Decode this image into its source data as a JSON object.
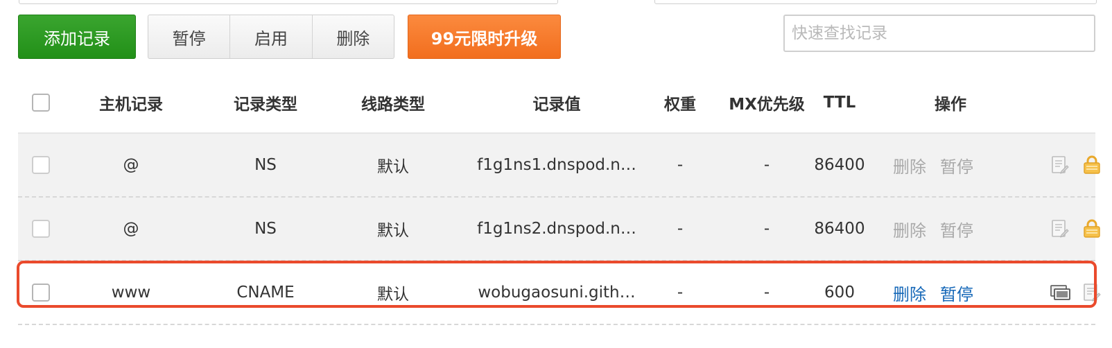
{
  "toolbar": {
    "add_label": "添加记录",
    "pause_label": "暂停",
    "enable_label": "启用",
    "delete_label": "删除",
    "upgrade_label": "99元限时升级",
    "search_placeholder": "快速查找记录"
  },
  "table": {
    "headers": {
      "host": "主机记录",
      "type": "记录类型",
      "line": "线路类型",
      "value": "记录值",
      "weight": "权重",
      "mx": "MX优先级",
      "ttl": "TTL",
      "ops": "操作"
    },
    "rows": [
      {
        "host": "@",
        "type": "NS",
        "line": "默认",
        "value": "f1g1ns1.dnspod.n…",
        "weight": "-",
        "mx": "-",
        "ttl": "86400",
        "delete": "删除",
        "pause": "暂停",
        "state": "disabled",
        "icons": [
          "edit-doc-icon",
          "lock-icon"
        ]
      },
      {
        "host": "@",
        "type": "NS",
        "line": "默认",
        "value": "f1g1ns2.dnspod.n…",
        "weight": "-",
        "mx": "-",
        "ttl": "86400",
        "delete": "删除",
        "pause": "暂停",
        "state": "disabled",
        "icons": [
          "edit-doc-icon",
          "lock-icon"
        ]
      },
      {
        "host": "www",
        "type": "CNAME",
        "line": "默认",
        "value": "wobugaosuni.gith…",
        "weight": "-",
        "mx": "-",
        "ttl": "600",
        "delete": "删除",
        "pause": "暂停",
        "state": "active",
        "icons": [
          "screens-icon",
          "edit-doc-icon"
        ]
      }
    ]
  },
  "colors": {
    "add_button": "#229018",
    "upgrade_button": "#f26e1e",
    "highlight_border": "#ea4a2c",
    "active_link": "#1668b8",
    "disabled_link": "#a9a9a9"
  }
}
